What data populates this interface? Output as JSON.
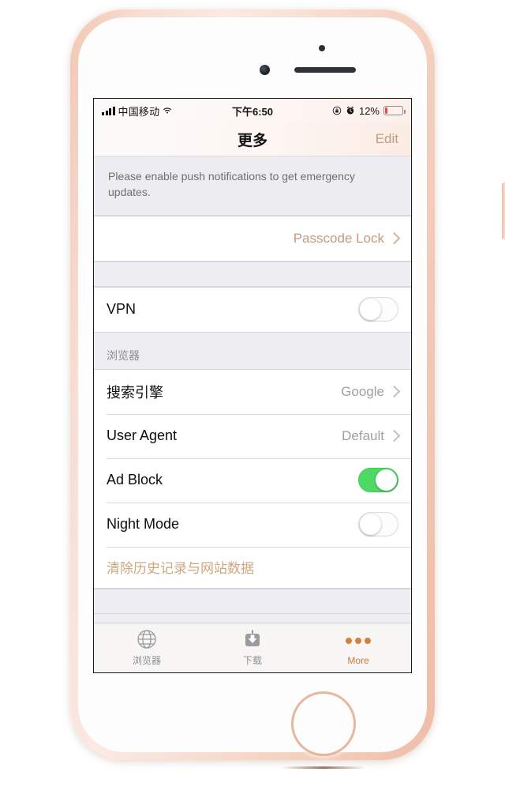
{
  "status_bar": {
    "carrier": "中国移动",
    "signal_icon": "signal-bars-icon",
    "wifi_icon": "wifi-icon",
    "time": "下午6:50",
    "rotation_lock_icon": "rotation-lock-icon",
    "alarm_icon": "alarm-clock-icon",
    "battery_percent": "12%",
    "battery_level": 12,
    "battery_color": "#e8464a"
  },
  "nav_bar": {
    "title": "更多",
    "edit_label": "Edit",
    "accent_color": "#c49a7d"
  },
  "banner": {
    "text": "Please enable push notifications to get emergency updates."
  },
  "passcode_group": {
    "rows": [
      {
        "label": "",
        "value": "Passcode Lock",
        "accessory": "chevron-right-icon"
      }
    ]
  },
  "vpn_group": {
    "rows": [
      {
        "label": "VPN",
        "toggle": "off"
      }
    ]
  },
  "browser_section": {
    "header": "浏览器",
    "rows": [
      {
        "label": "搜索引擎",
        "value": "Google",
        "accessory": "chevron-right-icon"
      },
      {
        "label": "User Agent",
        "value": "Default",
        "accessory": "chevron-right-icon"
      },
      {
        "label": "Ad Block",
        "toggle": "on"
      },
      {
        "label": "Night Mode",
        "toggle": "off"
      }
    ],
    "clear_action": "清除历史记录与网站数据"
  },
  "tab_bar": {
    "tabs": [
      {
        "label": "浏览器",
        "icon": "globe-icon",
        "active": false
      },
      {
        "label": "下载",
        "icon": "download-icon",
        "active": false
      },
      {
        "label": "More",
        "icon": "ellipsis-icon",
        "active": true
      }
    ],
    "active_color": "#c87b3e",
    "inactive_color": "#8e8e93"
  },
  "toggle_colors": {
    "on": "#4cd964",
    "off": "#fdfdfd"
  }
}
